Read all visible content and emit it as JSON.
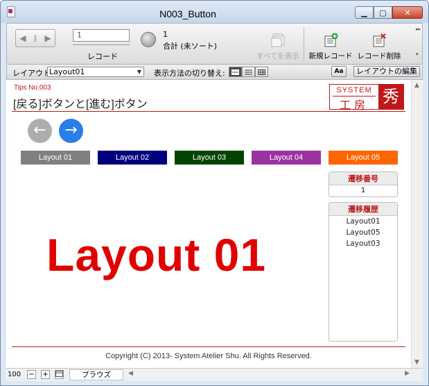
{
  "window": {
    "title": "N003_Button",
    "minimize": "▁",
    "maximize": "▢",
    "close": "✕"
  },
  "toolbar": {
    "record_value": "1",
    "record_label": "レコード",
    "found_count": "1",
    "sort_status": "合計 (未ソート)",
    "show_all": "すべてを表示",
    "new_record": "新規レコード",
    "delete_record": "レコード削除"
  },
  "layoutbar": {
    "layout_label": "レイアウト:",
    "layout_value": "Layout01",
    "view_as_label": "表示方法の切り替え:",
    "aa_label": "Aa",
    "edit_layout": "レイアウトの編集"
  },
  "content": {
    "tips": "Tips No.003",
    "page_title": "[戻る]ボタンと[進む]ボタン",
    "logo_top": "SYSTEM",
    "logo_bottom": "工房",
    "logo_seal": "秀",
    "back_arrow": "←",
    "forward_arrow": "→",
    "layout_buttons": [
      {
        "label": "Layout 01",
        "color": "#808080"
      },
      {
        "label": "Layout 02",
        "color": "#00007c"
      },
      {
        "label": "Layout 03",
        "color": "#004400"
      },
      {
        "label": "Layout 04",
        "color": "#9933a0"
      },
      {
        "label": "Layout 05",
        "color": "#ff6600"
      }
    ],
    "big_label": "Layout 01",
    "transition_number_label": "遷移番号",
    "transition_number": "1",
    "history_label": "遷移履歴",
    "history": [
      "Layout01",
      "Layout05",
      "Layout03"
    ],
    "copyright": "Copyright (C) 2013- System Atelier Shu. All Rights Reserved."
  },
  "statusbar": {
    "zoom": "100",
    "zoom_out": "−",
    "zoom_in": "+",
    "mode": "ブラウズ"
  },
  "colors": {
    "accent_red": "#c0181a",
    "headline_red": "#e00000",
    "forward_blue": "#2b7de8",
    "back_gray": "#adadad"
  }
}
